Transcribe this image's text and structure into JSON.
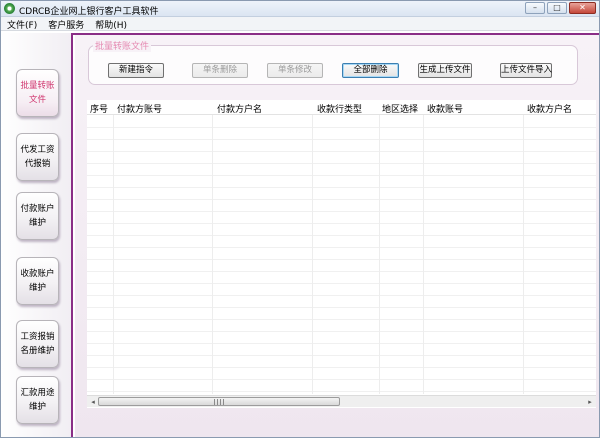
{
  "window": {
    "title": "CDRCB企业网上银行客户工具软件",
    "minimize_glyph": "–",
    "maximize_glyph": "□",
    "close_glyph": "✕"
  },
  "menu": [
    "文件(F)",
    "客户服务",
    "帮助(H)"
  ],
  "sidebar": [
    {
      "line1": "批量转账",
      "line2": "文件",
      "active": true
    },
    {
      "line1": "代发工资",
      "line2": "代报销"
    },
    {
      "line1": "付款账户",
      "line2": "维护"
    },
    {
      "line1": "收款账户",
      "line2": "维护"
    },
    {
      "line1": "工资报销",
      "line2": "名册维护"
    },
    {
      "line1": "汇款用途",
      "line2": "维护"
    }
  ],
  "panel": {
    "title": "批量转账文件",
    "buttons": {
      "new": "新建指令",
      "delete_one": "单条删除",
      "edit_one": "单条修改",
      "delete_all": "全部删除",
      "generate_upload": "生成上传文件",
      "import_upload": "上传文件导入"
    }
  },
  "table": {
    "columns": [
      "序号",
      "付款方账号",
      "付款方户名",
      "收款行类型",
      "地区选择",
      "收款账号",
      "收款方户名"
    ]
  },
  "scrollbar": {
    "left_arrow": "◂",
    "right_arrow": "▸"
  },
  "colors": {
    "accent": "#8a2e86",
    "active_nav_text": "#d0366f",
    "panel_title": "#e58ab2"
  }
}
